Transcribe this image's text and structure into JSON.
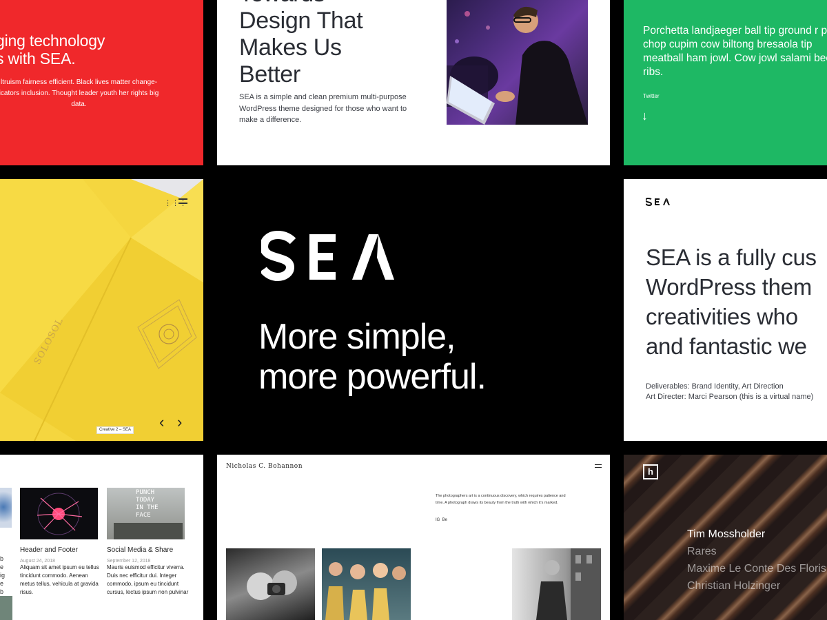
{
  "red": {
    "heading_line1": "ging technology",
    "heading_line2": "s with SEA.",
    "para_line1": "ltruism fairness efficient. Black lives matter change-",
    "para_line2": "icators inclusion. Thought leader youth her rights big",
    "para_line3": "data."
  },
  "design": {
    "heading_line0": "Towards",
    "heading_line1": "Design That",
    "heading_line2": "Makes Us",
    "heading_line3": "Better",
    "para": "SEA is a simple and clean premium multi-purpose WordPress theme designed for those who want to make a difference."
  },
  "green": {
    "para": "Porchetta landjaeger ball tip ground r pork chop cupim cow biltong bresaola tip meatball ham jowl. Cow jowl salami beef ribs.",
    "twitter": "Twitter",
    "arrow": "↓"
  },
  "yellow": {
    "book_text": "SOLOSOL",
    "caption": "Creative 2 – SEA",
    "prev": "‹",
    "next": "›"
  },
  "center": {
    "logo": "SEA",
    "tagline_line1": "More simple,",
    "tagline_line2": "more powerful."
  },
  "white": {
    "logo": "SEA",
    "heading_line1": "SEA is a fully cus",
    "heading_line2": "WordPress them",
    "heading_line3": "creativities who",
    "heading_line4": "and fantastic we",
    "deliverables": "Deliverables: Brand Identity, Art Direction",
    "director": "Art Directer: Marci Pearson (this is a virtual name)"
  },
  "blog": {
    "posts": [
      {
        "title": "Header and Footer",
        "date": "August 24, 2018",
        "excerpt": "Aliquam sit amet ipsum eu tellus tincidunt commodo. Aenean metus tellus, vehicula at gravida risus."
      },
      {
        "title": "Social Media & Share",
        "date": "September 12, 2018",
        "excerpt": "Mauris euismod efficitur viverra. Duis nec efficitur dui. Integer commodo, ipsum eu tincidunt cursus, lectus ipsum non pulvinar"
      }
    ],
    "punch_text": "PUNCH TODAY IN THE FACE"
  },
  "nick": {
    "name": "Nicholas C. Bohannon",
    "quote": "The photographers art is a continuous discovery, which requires patience and time. A photograph draws its beauty from the truth with which it's marked.",
    "social": "IG  Be"
  },
  "dark": {
    "names": [
      "Tim Mossholder",
      "Rares",
      "Maxime Le Conte Des Floris",
      "Christian Holzinger"
    ]
  }
}
